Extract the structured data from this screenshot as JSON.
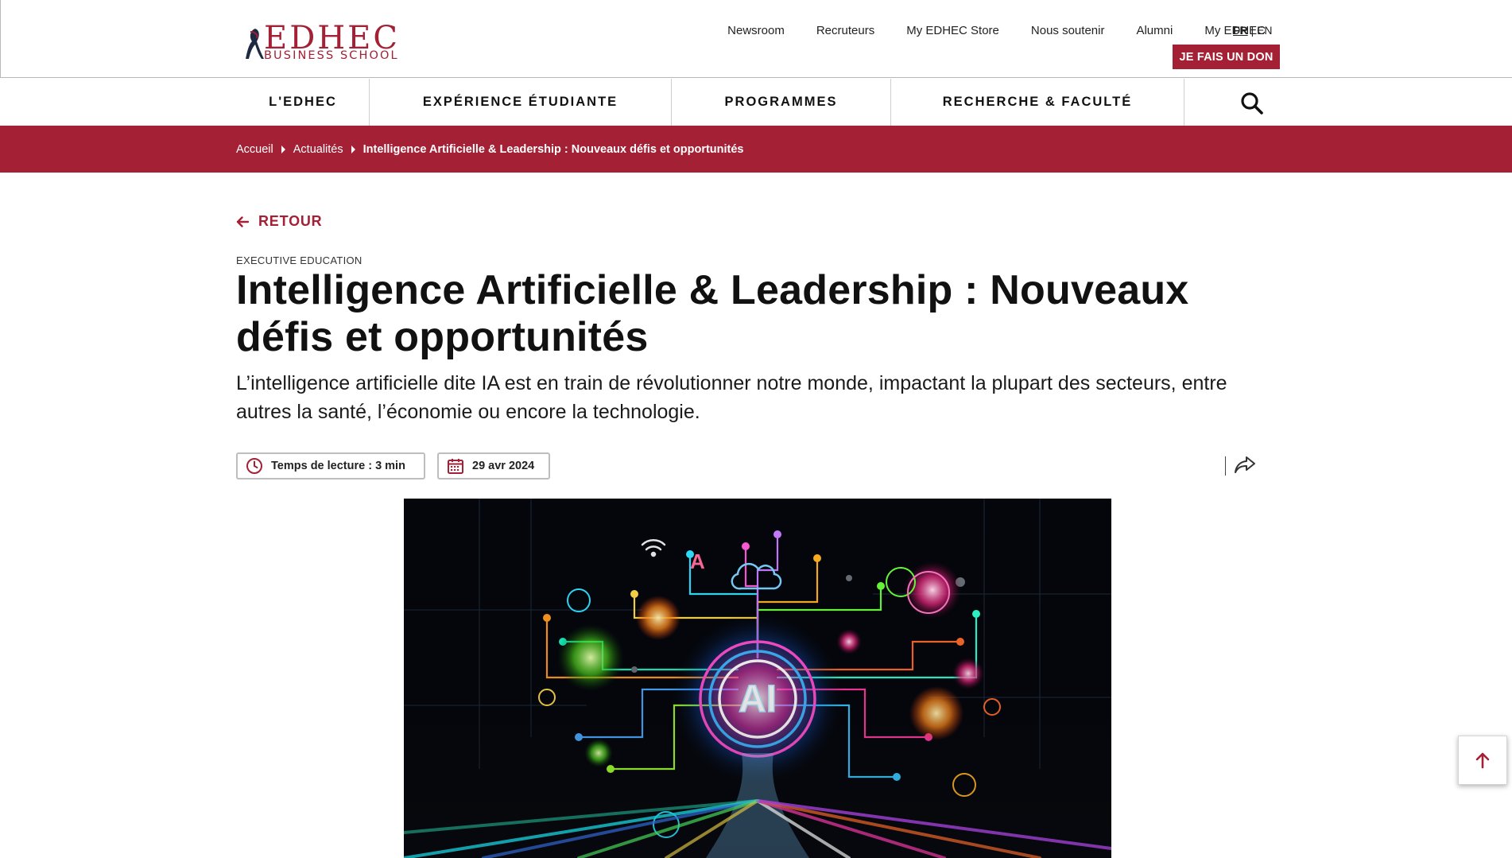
{
  "brand": {
    "logo_main": "EDHEC",
    "logo_sub": "BUSINESS SCHOOL",
    "accent": "#a32035"
  },
  "utility_nav": [
    "Newsroom",
    "Recruteurs",
    "My EDHEC Store",
    "Nous soutenir",
    "Alumni",
    "My EDHEC"
  ],
  "lang": {
    "fr": "FR",
    "sep": "|",
    "en": "EN"
  },
  "donate_label": "JE FAIS UN DON",
  "main_nav": [
    "L'EDHEC",
    "EXPÉRIENCE ÉTUDIANTE",
    "PROGRAMMES",
    "RECHERCHE & FACULTÉ"
  ],
  "breadcrumb": {
    "items": [
      "Accueil",
      "Actualités"
    ],
    "current": "Intelligence Artificielle & Leadership : Nouveaux défis et opportunités"
  },
  "article": {
    "back_label": "RETOUR",
    "category": "EXECUTIVE EDUCATION",
    "title": "Intelligence Artificielle & Leadership : Nouveaux défis et opportunités",
    "lead": "L’intelligence artificielle dite IA est en train de révolutionner notre monde, impactant la plupart des secteurs, entre autres la santé, l’économie ou encore la technologie.",
    "reading_time": "Temps de lecture : 3 min",
    "date": "29 avr 2024",
    "hero_text": "AI"
  },
  "icons": {
    "search": "search-icon",
    "clock": "clock-icon",
    "calendar": "calendar-icon",
    "share": "share-icon",
    "back": "arrow-left-icon",
    "top": "arrow-up-icon"
  }
}
